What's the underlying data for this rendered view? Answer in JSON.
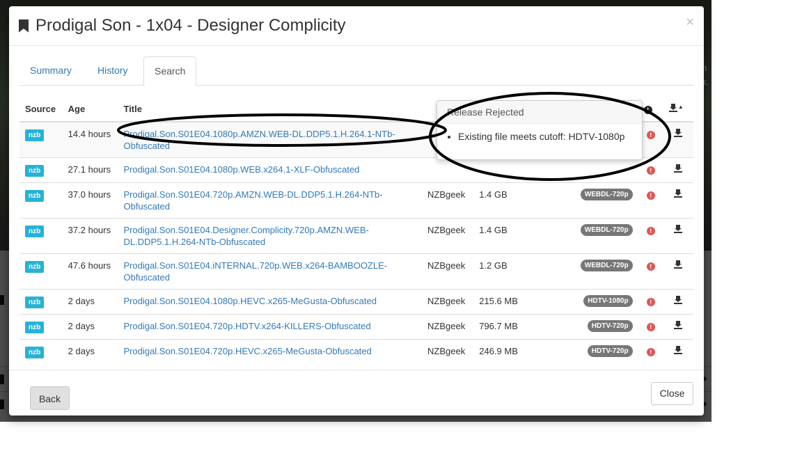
{
  "modal": {
    "title": "Prodigal Son - 1x04 - Designer Complicity",
    "close_glyph": "×",
    "tabs": [
      {
        "label": "Summary"
      },
      {
        "label": "History"
      },
      {
        "label": "Search",
        "active": true
      }
    ],
    "table": {
      "headers": {
        "source": "Source",
        "age": "Age",
        "title": "Title"
      },
      "rows": [
        {
          "source": "nzb",
          "age": "14.4 hours",
          "title": "Prodigal.Son.S01E04.1080p.AMZN.WEB-DL.DDP5.1.H.264.1-NTb-Obfuscated",
          "indexer": "",
          "size": "",
          "quality": ""
        },
        {
          "source": "nzb",
          "age": "27.1 hours",
          "title": "Prodigal.Son.S01E04.1080p.WEB.x264.1-XLF-Obfuscated",
          "indexer": "",
          "size": "",
          "quality": ""
        },
        {
          "source": "nzb",
          "age": "37.0 hours",
          "title": "Prodigal.Son.S01E04.720p.AMZN.WEB-DL.DDP5.1.H.264-NTb-Obfuscated",
          "indexer": "NZBgeek",
          "size": "1.4 GB",
          "quality": "WEBDL-720p"
        },
        {
          "source": "nzb",
          "age": "37.2 hours",
          "title": "Prodigal.Son.S01E04.Designer.Complicity.720p.AMZN.WEB-DL.DDP5.1.H.264-NTb-Obfuscated",
          "indexer": "NZBgeek",
          "size": "1.4 GB",
          "quality": "WEBDL-720p"
        },
        {
          "source": "nzb",
          "age": "47.6 hours",
          "title": "Prodigal.Son.S01E04.iNTERNAL.720p.WEB.x264-BAMBOOZLE-Obfuscated",
          "indexer": "NZBgeek",
          "size": "1.2 GB",
          "quality": "WEBDL-720p"
        },
        {
          "source": "nzb",
          "age": "2 days",
          "title": "Prodigal.Son.S01E04.1080p.HEVC.x265-MeGusta-Obfuscated",
          "indexer": "NZBgeek",
          "size": "215.6 MB",
          "quality": "HDTV-1080p"
        },
        {
          "source": "nzb",
          "age": "2 days",
          "title": "Prodigal.Son.S01E04.720p.HDTV.x264-KILLERS-Obfuscated",
          "indexer": "NZBgeek",
          "size": "796.7 MB",
          "quality": "HDTV-720p"
        },
        {
          "source": "nzb",
          "age": "2 days",
          "title": "Prodigal.Son.S01E04.720p.HEVC.x265-MeGusta-Obfuscated",
          "indexer": "NZBgeek",
          "size": "246.9 MB",
          "quality": "HDTV-720p"
        }
      ]
    },
    "back_label": "Back",
    "close_label": "Close"
  },
  "popover": {
    "title": "Release Rejected",
    "reasons": [
      "Existing file meets cutoff: HDTV-1080p"
    ]
  },
  "background": {
    "side_text_1": "n",
    "side_text_2": "k."
  },
  "colors": {
    "link": "#337ab7",
    "nzb_badge": "#27b2d6",
    "quality_badge": "#777777",
    "rejected_icon": "#e05555",
    "annotation": "#000000"
  }
}
